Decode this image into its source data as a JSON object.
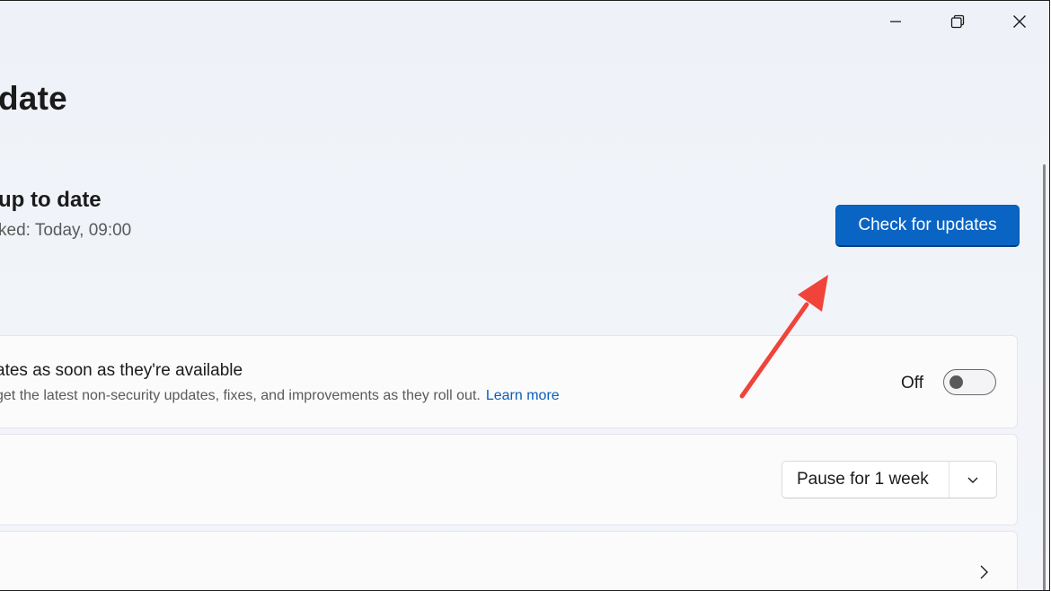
{
  "window": {
    "controls": {
      "minimize_icon": "minimize-icon",
      "maximize_icon": "restore-icon",
      "close_icon": "close-icon"
    }
  },
  "header": {
    "title": "date"
  },
  "status": {
    "title": "up to date",
    "last_checked": "ked: Today, 09:00",
    "check_button_label": "Check for updates"
  },
  "settings": {
    "latest_updates": {
      "title": "ates as soon as they're available",
      "description": "get the latest non-security updates, fixes, and improvements as they roll out.",
      "link_label": "Learn more",
      "toggle_label": "Off",
      "toggle_on": false
    },
    "pause": {
      "selected": "Pause for 1 week"
    }
  },
  "colors": {
    "accent": "#0a64c4",
    "link": "#0a5fb8",
    "annotation_arrow": "#f0443a"
  }
}
